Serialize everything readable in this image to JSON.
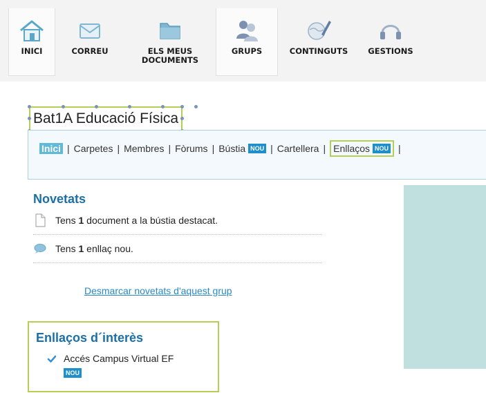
{
  "nav": {
    "items": [
      {
        "label": "INICI",
        "icon": "home-icon"
      },
      {
        "label": "CORREU",
        "icon": "envelope-icon"
      },
      {
        "label": "ELS MEUS\nDOCUMENTS",
        "icon": "folder-icon"
      },
      {
        "label": "GRUPS",
        "icon": "users-icon"
      },
      {
        "label": "CONTINGUTS",
        "icon": "globe-pen-icon"
      },
      {
        "label": "GESTIONS",
        "icon": "headset-icon"
      }
    ]
  },
  "group": {
    "title": "Bat1A Educació Física"
  },
  "submenu": {
    "items": [
      {
        "label": "Inici"
      },
      {
        "label": "Carpetes"
      },
      {
        "label": "Membres"
      },
      {
        "label": "Fòrums"
      },
      {
        "label": "Bústia",
        "badge": "NOU"
      },
      {
        "label": "Cartellera"
      },
      {
        "label": "Enllaços",
        "badge": "NOU"
      }
    ],
    "separator": "|"
  },
  "novetats": {
    "heading": "Novetats",
    "items": [
      {
        "prefix": "Tens ",
        "count": "1",
        "suffix": " document a la bústia destacat.",
        "icon": "document-icon"
      },
      {
        "prefix": "Tens ",
        "count": "1",
        "suffix": " enllaç nou.",
        "icon": "speech-bubble-icon"
      }
    ],
    "clear_link": "Desmarcar novetats d'aquest grup"
  },
  "links_of_interest": {
    "heading": "Enllaços d´interès",
    "items": [
      {
        "label": "Accés Campus Virtual EF",
        "badge": "NOU",
        "icon": "checkmark-icon"
      }
    ]
  },
  "colors": {
    "heading_blue": "#1b6fa7",
    "badge_blue": "#1f8fcb",
    "highlight_green": "#b5cf56",
    "panel_teal": "#bfe0df",
    "active_tab": "#5fb9d9"
  }
}
